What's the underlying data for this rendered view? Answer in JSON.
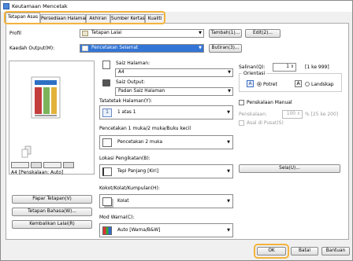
{
  "window": {
    "title": "Keutamaan Mencetak"
  },
  "tabs": [
    {
      "label": "Tetapan Asas",
      "active": true
    },
    {
      "label": "Persediaan Halaman",
      "active": false
    },
    {
      "label": "Akhiran",
      "active": false
    },
    {
      "label": "Sumber Kertas",
      "active": false
    },
    {
      "label": "Kualiti",
      "active": false
    }
  ],
  "profile": {
    "label": "Profil",
    "value": "Tetapan Lalai",
    "add_button": "Tambah(1)...",
    "edit_button": "Edit(2)..."
  },
  "output": {
    "label": "Kaedah Output(M):",
    "value": "Pencetakan Selamat",
    "pin_button": "Butiran(3)..."
  },
  "page_size": {
    "label": "Saiz Halaman:",
    "value": "A4"
  },
  "output_size": {
    "label": "Saiz Output:",
    "value": "Padan Saiz Halaman"
  },
  "layout": {
    "label": "Tatatetak Halaman(Y):",
    "value": "1 atas 1"
  },
  "duplex": {
    "label": "Pencetakan 1 muka/2 muka/Buku kecil",
    "value": "Pencetakan 2 muka"
  },
  "binding": {
    "label": "Lokasi Pengikatan(B):",
    "value": "Tepi Panjang [Kiri]",
    "setting_button": "Sela(U)..."
  },
  "collate": {
    "label": "Kokot/Kolat/Kumpulan(H):",
    "value": "Kolat"
  },
  "color_mode": {
    "label": "Mod Warna(C):",
    "value": "Auto [Warna/B&W]"
  },
  "copies": {
    "label": "Salinan(Q):",
    "value": "1",
    "range": "[1 ke 999]"
  },
  "orientation": {
    "legend": "Orientasi",
    "portrait": "Potret",
    "landscape": "Landskap",
    "selected": "portrait"
  },
  "manual_scaling": {
    "label": "Penskalaan Manual",
    "scale_label": "Penskalaan:",
    "scale_value": "100",
    "scale_range": "% [25 ke 200]",
    "center_label": "Asal di Pusat(S)"
  },
  "preview": {
    "caption": "A4 [Penskalaan: Auto]"
  },
  "left_buttons": {
    "page_settings": "Papar Tetapan(V)",
    "language": "Tetapan Bahasa(W)...",
    "restore": "Kembalikan Lalai(R)"
  },
  "footer": {
    "ok": "OK",
    "cancel": "Batal",
    "help": "Bantuan"
  },
  "colors": {
    "accent": "#3375d6",
    "highlight": "#f4b33c"
  }
}
